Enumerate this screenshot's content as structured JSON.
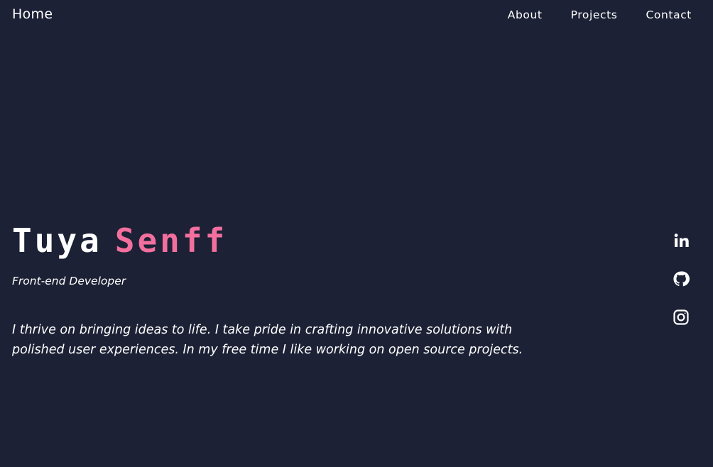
{
  "nav": {
    "home": "Home",
    "links": [
      "About",
      "Projects",
      "Contact"
    ]
  },
  "hero": {
    "first_name": "Tuya",
    "last_name": "Senff",
    "title": "Front-end Developer",
    "bio": "I thrive on bringing ideas to life. I take pride in crafting innovative solutions with polished user experiences. In my free time I like working on open source projects."
  },
  "social": {
    "icons": [
      "linkedin-icon",
      "github-icon",
      "instagram-icon"
    ]
  },
  "colors": {
    "background": "#1c2135",
    "accent": "#f26f9e",
    "text": "#ffffff"
  }
}
